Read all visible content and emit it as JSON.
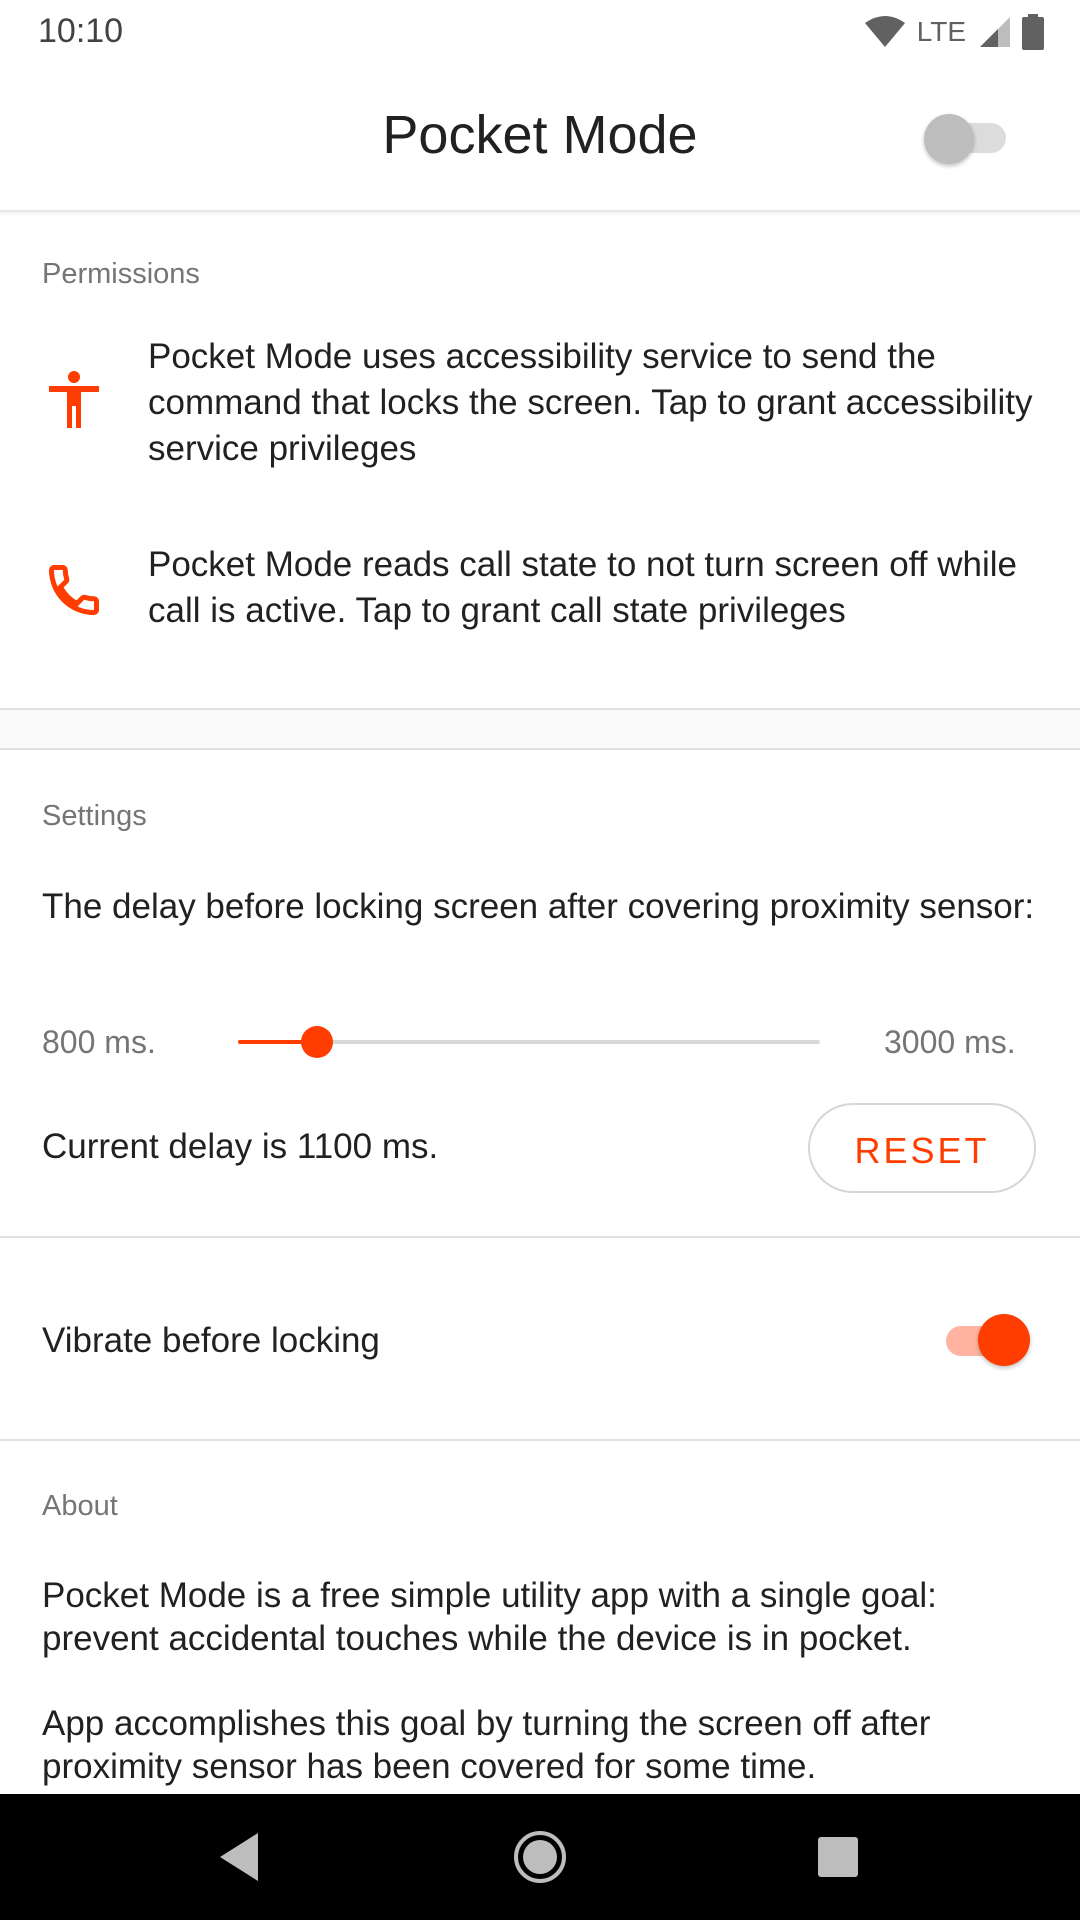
{
  "status_bar": {
    "time": "10:10",
    "network_label": "LTE",
    "icons": [
      "wifi-icon",
      "signal-icon",
      "battery-icon"
    ]
  },
  "app_bar": {
    "title": "Pocket Mode",
    "service_enabled": false
  },
  "permissions": {
    "label": "Permissions",
    "items": [
      {
        "icon": "accessibility-icon",
        "text": "Pocket Mode uses accessibility service to send the command that locks the screen. Tap to grant accessibility service privileges"
      },
      {
        "icon": "phone-icon",
        "text": "Pocket Mode reads call state to not turn screen off while call is active. Tap to grant call state privileges"
      }
    ]
  },
  "settings": {
    "label": "Settings",
    "delay_description": "The delay before locking screen after covering proximity sensor:",
    "slider": {
      "min_label": "800 ms.",
      "max_label": "3000 ms.",
      "min_value": 800,
      "max_value": 3000,
      "value": 1100
    },
    "current_delay_text": "Current delay is 1100 ms.",
    "reset_label": "RESET",
    "vibrate_label": "Vibrate before locking",
    "vibrate_enabled": true
  },
  "about": {
    "label": "About",
    "paragraph1": "Pocket Mode is a free simple utility app with a single goal: prevent accidental touches while the device is in pocket.",
    "paragraph2": "App accomplishes this goal by turning the screen off after proximity sensor has been covered for some time."
  },
  "colors": {
    "accent": "#ff3d00",
    "accent_light": "#ffb3a0",
    "switch_off_thumb": "#bdbdbd"
  },
  "nav_bar": {
    "buttons": [
      "back-icon",
      "home-icon",
      "recents-icon"
    ]
  }
}
